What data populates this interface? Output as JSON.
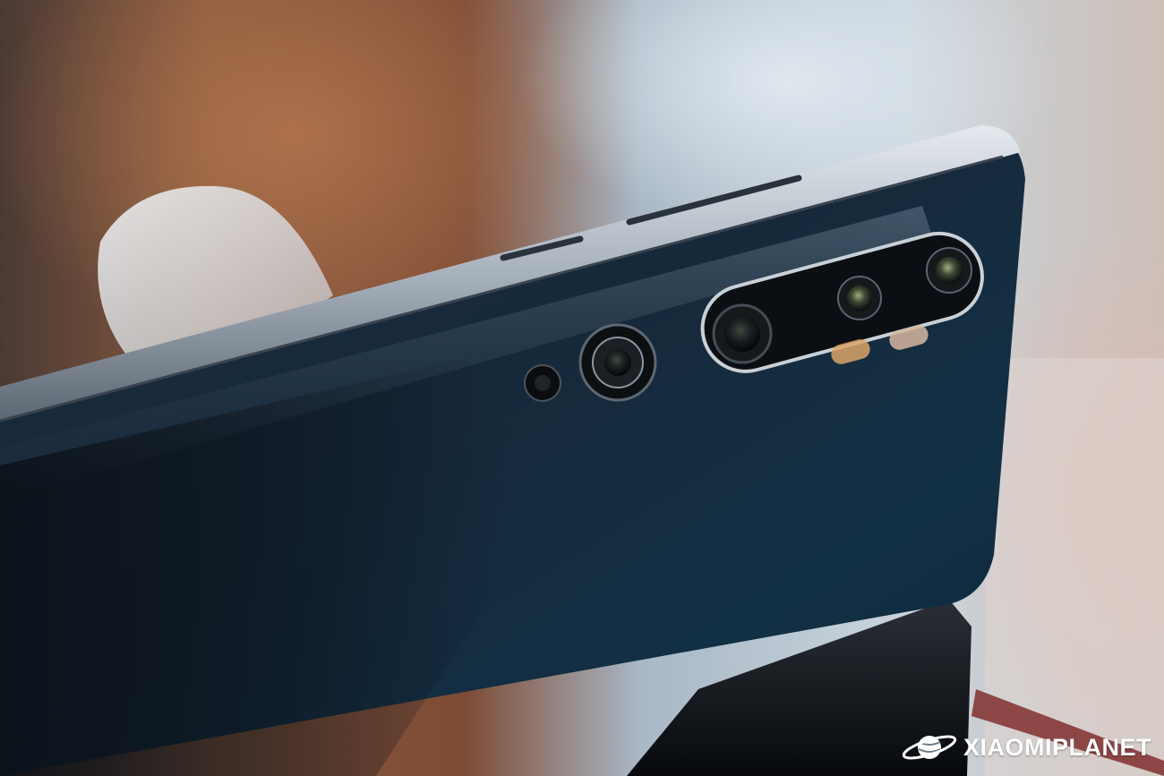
{
  "image": {
    "subject": "phone",
    "colors": {
      "body": "#13283a",
      "frame": "#b9c2cc",
      "background_warm": "#8a5a3e",
      "background_cool": "#9fb3c3",
      "stand": "#0e1116"
    }
  },
  "watermark": {
    "text": "XIAOMIPLANET",
    "icon": "planet-logo-icon",
    "color": "#ffffff"
  }
}
